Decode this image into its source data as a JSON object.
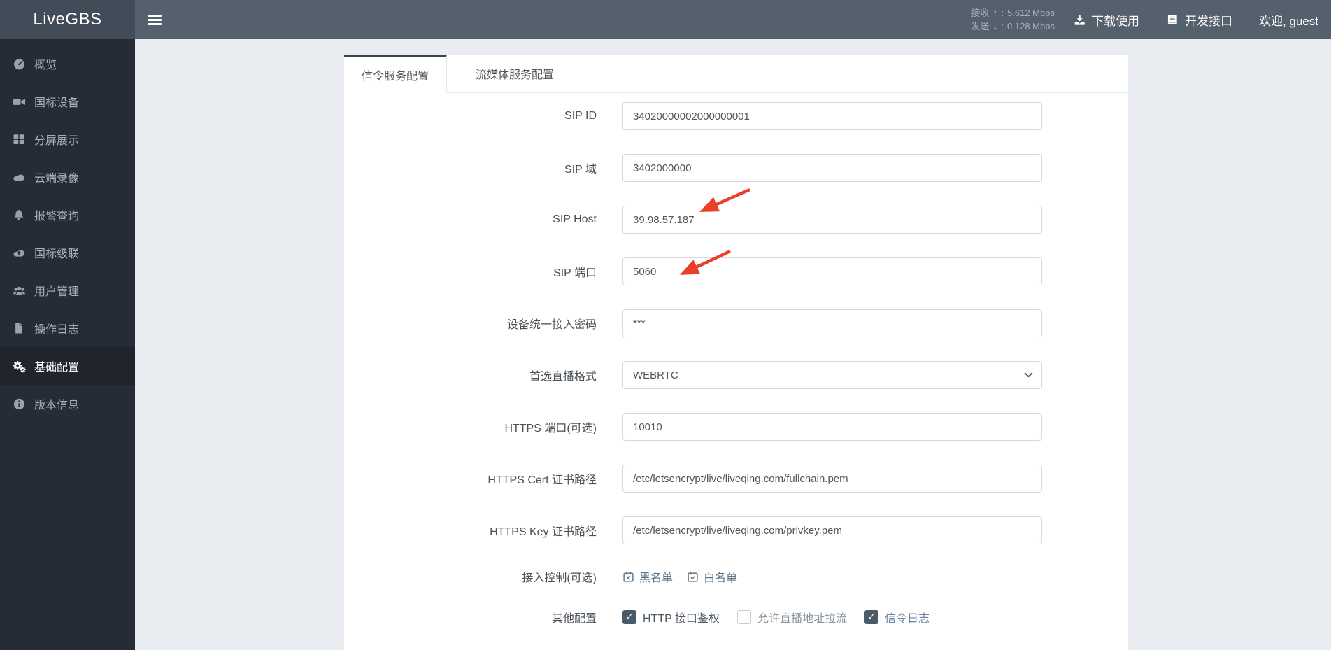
{
  "app": {
    "logo": "LiveGBS"
  },
  "header": {
    "stats": {
      "receive_label": "接收",
      "receive_sep": ":",
      "receive_value": "5.612 Mbps",
      "send_label": "发送",
      "send_sep": ":",
      "send_value": "0.128 Mbps"
    },
    "nav": {
      "download": "下载使用",
      "api": "开发接口",
      "welcome": "欢迎, guest"
    }
  },
  "sidebar": {
    "items": [
      {
        "label": "概览",
        "icon": "gauge-icon",
        "active": false
      },
      {
        "label": "国标设备",
        "icon": "video-camera-icon",
        "active": false
      },
      {
        "label": "分屏展示",
        "icon": "grid-icon",
        "active": false
      },
      {
        "label": "云端录像",
        "icon": "cloud-icon",
        "active": false
      },
      {
        "label": "报警查询",
        "icon": "bell-icon",
        "active": false
      },
      {
        "label": "国标级联",
        "icon": "cloud-upload-icon",
        "active": false
      },
      {
        "label": "用户管理",
        "icon": "users-icon",
        "active": false
      },
      {
        "label": "操作日志",
        "icon": "file-icon",
        "active": false
      },
      {
        "label": "基础配置",
        "icon": "cogs-icon",
        "active": true
      },
      {
        "label": "版本信息",
        "icon": "info-circle-icon",
        "active": false
      }
    ]
  },
  "tabs": [
    {
      "label": "信令服务配置",
      "active": true
    },
    {
      "label": "流媒体服务配置",
      "active": false
    }
  ],
  "form": {
    "fields": [
      {
        "label": "SIP ID",
        "value": "34020000002000000001",
        "control": "input"
      },
      {
        "label": "SIP 域",
        "value": "3402000000",
        "control": "input"
      },
      {
        "label": "SIP Host",
        "value": "39.98.57.187",
        "control": "input"
      },
      {
        "label": "SIP 端口",
        "value": "5060",
        "control": "input"
      },
      {
        "label": "设备统一接入密码",
        "value": "***",
        "control": "input"
      },
      {
        "label": "首选直播格式",
        "value": "WEBRTC",
        "control": "select"
      },
      {
        "label": "HTTPS 端口(可选)",
        "value": "10010",
        "control": "input"
      },
      {
        "label": "HTTPS Cert 证书路径",
        "value": "/etc/letsencrypt/live/liveqing.com/fullchain.pem",
        "control": "input"
      },
      {
        "label": "HTTPS Key 证书路径",
        "value": "/etc/letsencrypt/live/liveqing.com/privkey.pem",
        "control": "input"
      }
    ],
    "access_control": {
      "label": "接入控制(可选)",
      "blacklist": "黑名单",
      "whitelist": "白名单"
    },
    "other": {
      "label": "其他配置",
      "checkboxes": [
        {
          "label": "HTTP 接口鉴权",
          "checked": true
        },
        {
          "label": "允许直播地址拉流",
          "checked": false
        },
        {
          "label": "信令日志",
          "checked": true
        }
      ]
    }
  },
  "colors": {
    "header_bg": "#55606d",
    "logo_bg": "#424c58",
    "sidebar_bg": "#262c36",
    "sidebar_active_bg": "#20242c",
    "tab_top_border": "#3b4551",
    "annotation_arrow": "#e8402a",
    "link": "#5e7488",
    "checked_box": "#4b5a68"
  }
}
